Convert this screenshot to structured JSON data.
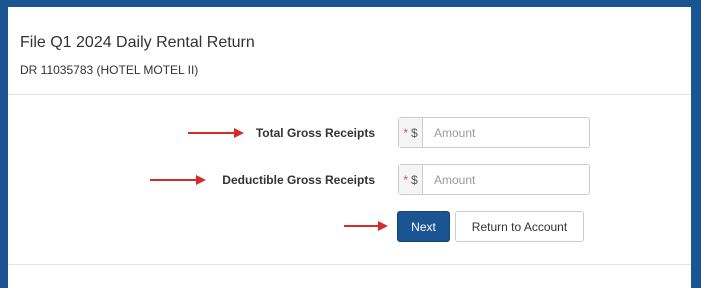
{
  "header": {
    "title": "File Q1 2024 Daily Rental Return",
    "subtitle": "DR 11035783 (HOTEL MOTEL II)"
  },
  "form": {
    "fields": [
      {
        "label": "Total Gross Receipts",
        "required_mark": "*",
        "currency": "$",
        "placeholder": "Amount",
        "value": ""
      },
      {
        "label": "Deductible Gross Receipts",
        "required_mark": "*",
        "currency": "$",
        "placeholder": "Amount",
        "value": ""
      }
    ]
  },
  "actions": {
    "next_label": "Next",
    "return_label": "Return to Account"
  },
  "colors": {
    "frame": "#1b5493",
    "primary_button": "#1b5493",
    "annotation_arrow": "#d42b2b",
    "required_mark": "#d9534f"
  },
  "icons": {
    "annotation": "red-arrow-right-icon"
  }
}
